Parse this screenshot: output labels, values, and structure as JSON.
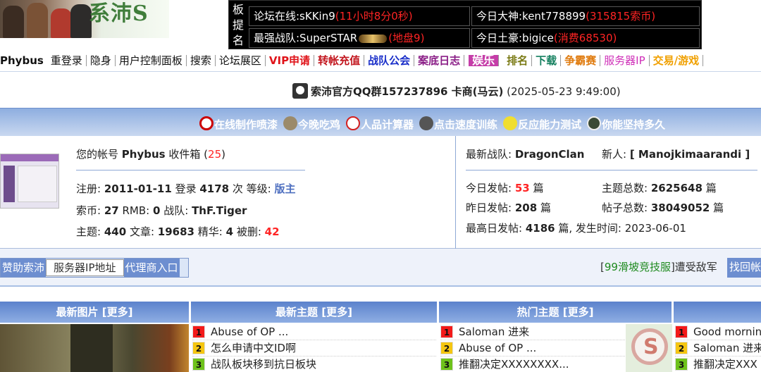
{
  "banner": {
    "text": "系沛S"
  },
  "board": {
    "label": [
      "板",
      "提",
      "名"
    ],
    "online_prefix": "论坛在线:sKKin9",
    "online_time": "(11小时8分0秒)",
    "daily_prefix": "今日大神:kent778899",
    "daily_value": "(315815索币)",
    "clan_prefix": "最强战队:SuperSTAR",
    "clan_badge": "SuperSTAR",
    "clan_value": "(地盘9)",
    "rich_prefix": "今日土豪:bigice",
    "rich_value": "(消费68530)"
  },
  "nav": {
    "items": [
      {
        "label": "Phybus",
        "color": "#111111",
        "bold": true
      },
      {
        "label": "重登录",
        "color": "#111111"
      },
      {
        "label": "隐身",
        "color": "#111111"
      },
      {
        "label": "用户控制面板",
        "color": "#111111"
      },
      {
        "label": "搜索",
        "color": "#111111"
      },
      {
        "label": "论坛展区",
        "color": "#111111"
      },
      {
        "label": "VIP申请",
        "color": "#e0141a",
        "bold": true
      },
      {
        "label": "转帐充值",
        "color": "#c2151d",
        "bold": true
      },
      {
        "label": "战队公会",
        "color": "#1a2fc9",
        "bold": true
      },
      {
        "label": "案底日志",
        "color": "#8a1d86",
        "bold": true
      },
      {
        "label": "娱乐",
        "ent": true
      },
      {
        "label": "排名",
        "color": "#7a7a14",
        "bold": true
      },
      {
        "label": "下载",
        "color": "#15805f",
        "bold": true
      },
      {
        "label": "争霸赛",
        "color": "#e07c10",
        "bold": true
      },
      {
        "label": "服务器IP",
        "color": "#cf2fb8"
      },
      {
        "label": "交易/游戏",
        "color": "#f0a000",
        "bold": true
      }
    ]
  },
  "qq_line": {
    "text": "索沛官方QQ群157237896 卡商(马云)",
    "time": "(2025-05-23 9:49:00)"
  },
  "links": [
    {
      "label": "在线制作喷漆",
      "color": "#cc0000"
    },
    {
      "label": "今晚吃鸡",
      "color": "#9b8a6a"
    },
    {
      "label": "人品计算器",
      "color": "#d42020"
    },
    {
      "label": "点击速度训练",
      "color": "#555555"
    },
    {
      "label": "反应能力测试",
      "color": "#e8d21c"
    },
    {
      "label": "你能坚持多久",
      "color": "#4c5a48"
    }
  ],
  "account": {
    "l1_a": "您的帐号",
    "name": "Phybus",
    "l1_b": "收件箱",
    "inbox_open": "(",
    "inbox": "25",
    "inbox_close": ")",
    "reg_label": "注册:",
    "reg_date": "2011-01-11",
    "login_label": "登录",
    "login_count": "4178",
    "login_unit": "次 等级:",
    "level": "版主",
    "coin_label": "索币:",
    "coins": "27",
    "rmb_label": "RMB:",
    "rmb": "0",
    "team_label": "战队:",
    "team": "ThF.Tiger",
    "topic_label": "主题:",
    "topics": "440",
    "article_label": "文章:",
    "articles": "19683",
    "essence_label": "精华:",
    "essence": "4",
    "deleted_label": "被删:",
    "deleted": "42"
  },
  "stats": {
    "latest_clan_label": "最新战队:",
    "latest_clan": "DragonClan",
    "newbie_label": "新人:",
    "newbie": "[ Manojkimaarandi ]",
    "today_label": "今日发帖:",
    "today": "53",
    "unit": "篇",
    "yesterday_label": "昨日发帖:",
    "yesterday": "208",
    "topics_total_label": "主题总数:",
    "topics_total": "2625648",
    "posts_total_label": "帖子总数:",
    "posts_total": "38049052",
    "peak_label": "最高日发帖:",
    "peak": "4186",
    "peak_mid": "篇, 发生时间:",
    "peak_date": "2023-06-01"
  },
  "midbar": {
    "sponsor": "赞助索沛",
    "server_ip": "服务器IP地址",
    "agent": "代理商入口",
    "ad_open": "[",
    "ad_link": "99滑坡竞技服",
    "ad_close": "]遭受敌军",
    "recover": "找回帐"
  },
  "sections": {
    "pics": "最新图片 [更多]",
    "new_topics": "最新主题 [更多]",
    "hot_topics": "热门主题 [更多]",
    "new_topics_list": [
      {
        "n": "1",
        "t": "Abuse of OP ..."
      },
      {
        "n": "2",
        "t": "怎么申请中文ID啊"
      },
      {
        "n": "3",
        "t": "战队板块移到抗日板块"
      }
    ],
    "hot_topics_list": [
      {
        "n": "1",
        "t": "Saloman 进来"
      },
      {
        "n": "2",
        "t": "Abuse of OP ..."
      },
      {
        "n": "3",
        "t": "推翻决定XXXXXXXX..."
      }
    ],
    "fourth_list": [
      {
        "n": "1",
        "t": "Good mornin"
      },
      {
        "n": "2",
        "t": "Saloman 进来"
      },
      {
        "n": "3",
        "t": "推翻决定XXX"
      }
    ]
  }
}
